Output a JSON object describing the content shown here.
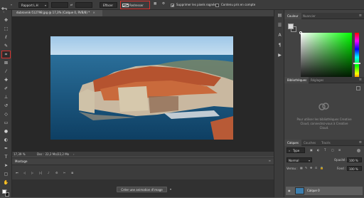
{
  "options": {
    "ratio_label": "Rapport L.H",
    "place_label": "Effacer",
    "straighten_label": "Redresser",
    "delete_cropped_label": "Supprimer les pixels rognés",
    "content_aware_label": "Contenu pris en compte"
  },
  "document": {
    "tab_title": "dubrovnik-512798.jpg @ 17,3% (Calque 0, RVB/8) *",
    "zoom": "17,39 %",
    "doc_size": "Doc : 22,2 Mo/22,2 Mo"
  },
  "timeline": {
    "title": "Montage",
    "create_button": "Créer une animation d'image"
  },
  "color_panel": {
    "tabs": [
      "Couleur",
      "Nuancier"
    ],
    "fg": "#d9d9d9",
    "bg": "#3a3a3a"
  },
  "libraries_panel": {
    "tabs": [
      "Bibliothèques",
      "Réglages"
    ],
    "message": "Pour utiliser les bibliothèques Creative Cloud, connectez-vous à Creative Cloud."
  },
  "layers_panel": {
    "tabs": [
      "Calques",
      "Couches",
      "Tracés"
    ],
    "filter_kind": "Type",
    "blend_mode": "Normal",
    "opacity_label": "Opacité :",
    "opacity_value": "100 %",
    "lock_label": "Verrou :",
    "fill_label": "Fond :",
    "fill_value": "100 %",
    "layer_name": "Calque 0"
  }
}
